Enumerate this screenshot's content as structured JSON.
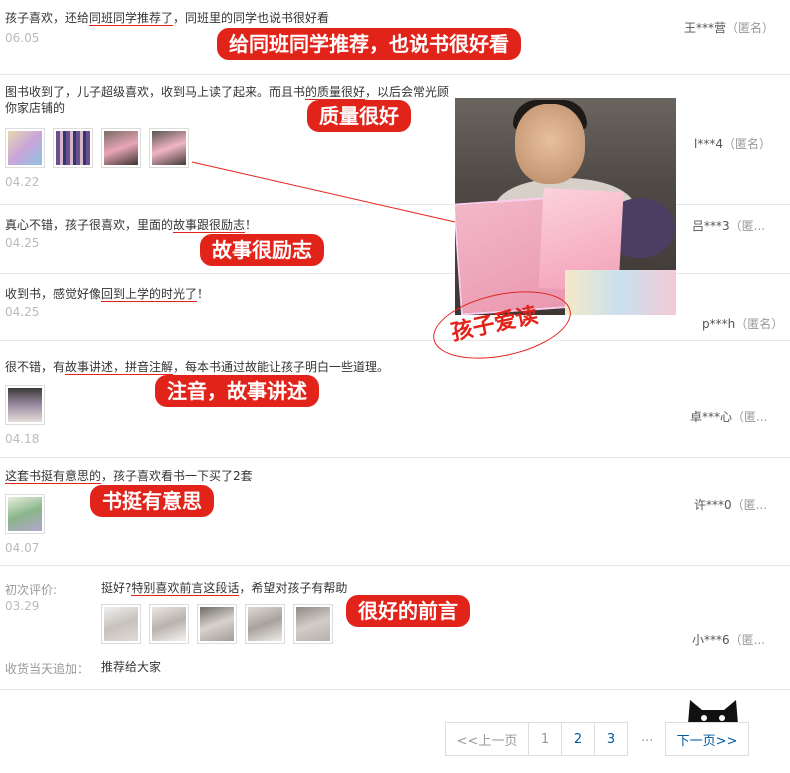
{
  "reviews": [
    {
      "text_pre": "孩子喜欢，还给",
      "text_ul": "同班同学推荐了",
      "text_mid": "，同班里的同学也说书很好看",
      "date": "06.05",
      "user": "王***营",
      "anon": "（匿名）"
    },
    {
      "text_pre": "图书收到了，儿子超级喜欢，收到马上读了起来。而且书",
      "text_ul": "的质量很好",
      "text_mid": "，以后会常光顾你家店铺的",
      "date": "04.22",
      "user": "l***4",
      "anon": "（匿名）"
    },
    {
      "text_pre": "真心不错，孩子很喜欢，里面的",
      "text_ul": "故事跟很励志",
      "text_mid": "！",
      "date": "04.25",
      "user": "吕***3",
      "anon": "（匿..."
    },
    {
      "text_pre": "收到书，感觉好像",
      "text_ul": "回到上学的时光了",
      "text_mid": "！",
      "date": "04.25",
      "user": "p***h",
      "anon": "（匿名）"
    },
    {
      "text_pre": "很不错，有",
      "text_ul": "故事讲述，拼音注解",
      "text_mid": "，每本书通过故能让孩子明白一些道理。",
      "date": "04.18",
      "user": "卓***心",
      "anon": "（匿..."
    },
    {
      "text_pre": "",
      "text_ul": "这套书挺有意思的",
      "text_mid": "，孩子喜欢看书一下买了2套",
      "date": "04.07",
      "user": "许***0",
      "anon": "（匿..."
    },
    {
      "label": "初次评价:",
      "text_pre": "挺好?",
      "text_ul": "特别喜欢前言这段话",
      "text_mid": "，希望对孩子有帮助",
      "date": "03.29",
      "user": "小***6",
      "anon": "（匿...",
      "append_label": "收货当天追加：",
      "append_text": "推荐给大家"
    }
  ],
  "callouts": {
    "c1": "给同班同学推荐，也说书很好看",
    "c2": "质量很好",
    "c3": "故事很励志",
    "c4": "注音，故事讲述",
    "c5": "书挺有意思",
    "c6": "很好的前言",
    "photo_label": "孩子爱读"
  },
  "pager": {
    "prev": "<<上一页",
    "pages": [
      "1",
      "2",
      "3"
    ],
    "ellipsis": "...",
    "next": "下一页>>"
  },
  "colors": {
    "accent": "#e2231a",
    "link": "#005aa0",
    "muted": "#bbbbbb"
  }
}
